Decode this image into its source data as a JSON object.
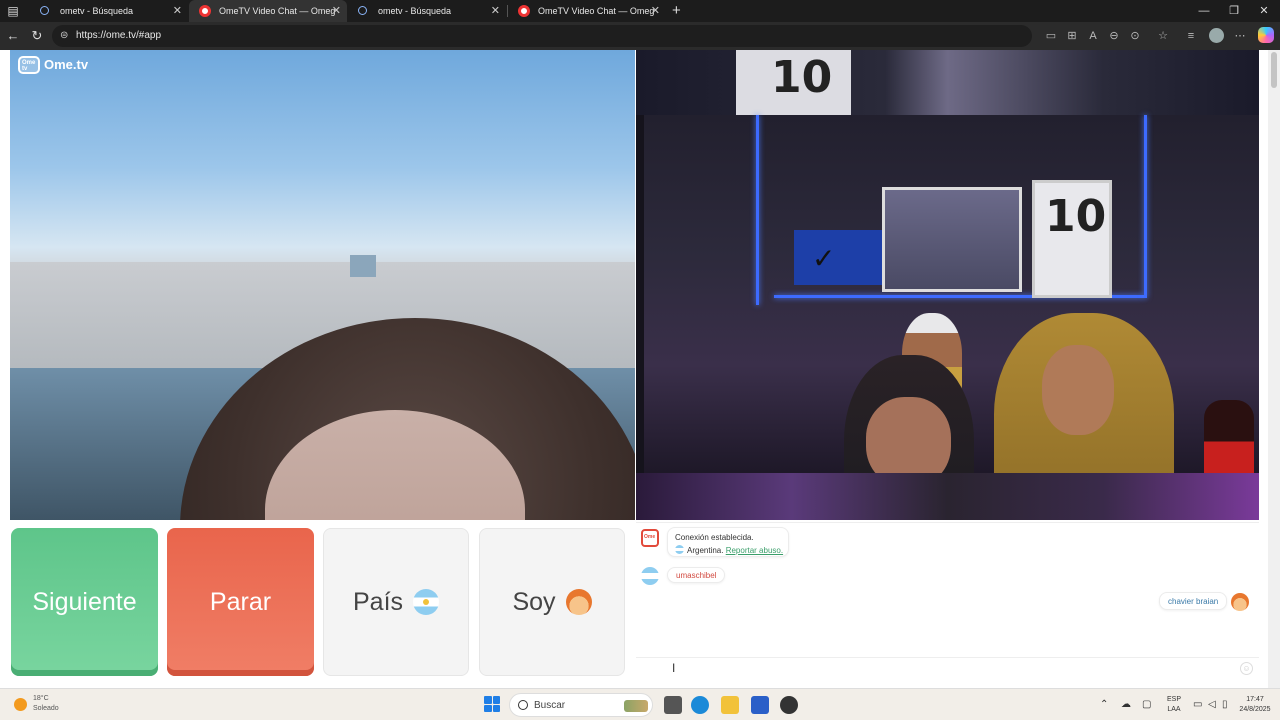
{
  "browser": {
    "tabs": [
      {
        "title": "ometv - Búsqueda",
        "icon": "search-icon",
        "active": false
      },
      {
        "title": "OmeTV Video Chat — Omeg",
        "icon": "recording-icon",
        "active": true
      },
      {
        "title": "ometv - Búsqueda",
        "icon": "search-icon",
        "active": false
      },
      {
        "title": "OmeTV Video Chat — Omeg",
        "icon": "recording-icon",
        "active": false
      }
    ],
    "new_tab": "+",
    "url": "https://ome.tv/#app",
    "window_controls": {
      "minimize": "—",
      "maximize": "❐",
      "close": "✕"
    }
  },
  "app": {
    "logo_text": "Ome.tv",
    "logo_badge": "Ome tv",
    "buttons": {
      "next": "Siguiente",
      "stop": "Parar",
      "country": "País",
      "gender": "Soy"
    },
    "chat": {
      "system_message": "Conexión establecida.",
      "country": "Argentina.",
      "report_link": "Reportar abuso.",
      "stranger_message": "umaschibel",
      "my_message": "chavier braian"
    },
    "video_right": {
      "jersey_number": "10"
    }
  },
  "taskbar": {
    "weather_temp": "18°C",
    "weather_desc": "Soleado",
    "search_placeholder": "Buscar",
    "language_top": "ESP",
    "language_bottom": "LAA",
    "time": "17:47",
    "date": "24/8/2025"
  },
  "colors": {
    "next_button": "#5ec58a",
    "stop_button": "#e9654c",
    "report_link": "#3a9e6a",
    "stranger_text": "#d24a40",
    "my_text": "#3a7aa8"
  }
}
